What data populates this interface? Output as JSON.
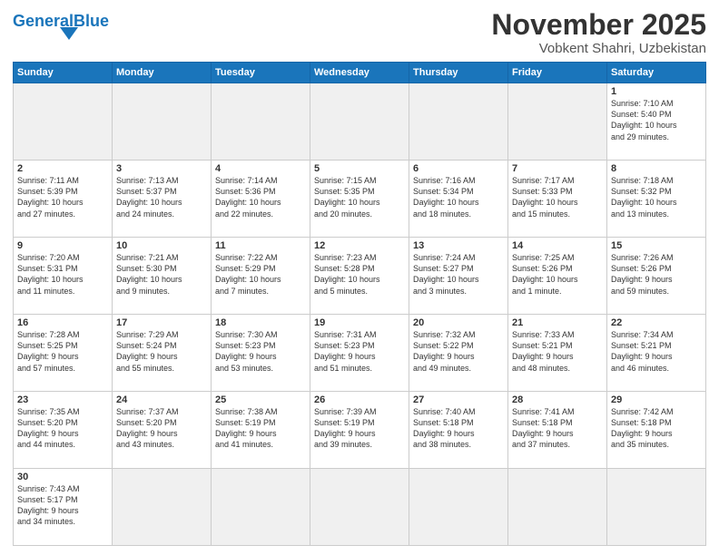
{
  "header": {
    "logo_general": "General",
    "logo_blue": "Blue",
    "month": "November 2025",
    "location": "Vobkent Shahri, Uzbekistan"
  },
  "weekdays": [
    "Sunday",
    "Monday",
    "Tuesday",
    "Wednesday",
    "Thursday",
    "Friday",
    "Saturday"
  ],
  "rows": [
    [
      {
        "day": "",
        "info": "",
        "empty": true
      },
      {
        "day": "",
        "info": "",
        "empty": true
      },
      {
        "day": "",
        "info": "",
        "empty": true
      },
      {
        "day": "",
        "info": "",
        "empty": true
      },
      {
        "day": "",
        "info": "",
        "empty": true
      },
      {
        "day": "",
        "info": "",
        "empty": true
      },
      {
        "day": "1",
        "info": "Sunrise: 7:10 AM\nSunset: 5:40 PM\nDaylight: 10 hours\nand 29 minutes."
      }
    ],
    [
      {
        "day": "2",
        "info": "Sunrise: 7:11 AM\nSunset: 5:39 PM\nDaylight: 10 hours\nand 27 minutes."
      },
      {
        "day": "3",
        "info": "Sunrise: 7:13 AM\nSunset: 5:37 PM\nDaylight: 10 hours\nand 24 minutes."
      },
      {
        "day": "4",
        "info": "Sunrise: 7:14 AM\nSunset: 5:36 PM\nDaylight: 10 hours\nand 22 minutes."
      },
      {
        "day": "5",
        "info": "Sunrise: 7:15 AM\nSunset: 5:35 PM\nDaylight: 10 hours\nand 20 minutes."
      },
      {
        "day": "6",
        "info": "Sunrise: 7:16 AM\nSunset: 5:34 PM\nDaylight: 10 hours\nand 18 minutes."
      },
      {
        "day": "7",
        "info": "Sunrise: 7:17 AM\nSunset: 5:33 PM\nDaylight: 10 hours\nand 15 minutes."
      },
      {
        "day": "8",
        "info": "Sunrise: 7:18 AM\nSunset: 5:32 PM\nDaylight: 10 hours\nand 13 minutes."
      }
    ],
    [
      {
        "day": "9",
        "info": "Sunrise: 7:20 AM\nSunset: 5:31 PM\nDaylight: 10 hours\nand 11 minutes."
      },
      {
        "day": "10",
        "info": "Sunrise: 7:21 AM\nSunset: 5:30 PM\nDaylight: 10 hours\nand 9 minutes."
      },
      {
        "day": "11",
        "info": "Sunrise: 7:22 AM\nSunset: 5:29 PM\nDaylight: 10 hours\nand 7 minutes."
      },
      {
        "day": "12",
        "info": "Sunrise: 7:23 AM\nSunset: 5:28 PM\nDaylight: 10 hours\nand 5 minutes."
      },
      {
        "day": "13",
        "info": "Sunrise: 7:24 AM\nSunset: 5:27 PM\nDaylight: 10 hours\nand 3 minutes."
      },
      {
        "day": "14",
        "info": "Sunrise: 7:25 AM\nSunset: 5:26 PM\nDaylight: 10 hours\nand 1 minute."
      },
      {
        "day": "15",
        "info": "Sunrise: 7:26 AM\nSunset: 5:26 PM\nDaylight: 9 hours\nand 59 minutes."
      }
    ],
    [
      {
        "day": "16",
        "info": "Sunrise: 7:28 AM\nSunset: 5:25 PM\nDaylight: 9 hours\nand 57 minutes."
      },
      {
        "day": "17",
        "info": "Sunrise: 7:29 AM\nSunset: 5:24 PM\nDaylight: 9 hours\nand 55 minutes."
      },
      {
        "day": "18",
        "info": "Sunrise: 7:30 AM\nSunset: 5:23 PM\nDaylight: 9 hours\nand 53 minutes."
      },
      {
        "day": "19",
        "info": "Sunrise: 7:31 AM\nSunset: 5:23 PM\nDaylight: 9 hours\nand 51 minutes."
      },
      {
        "day": "20",
        "info": "Sunrise: 7:32 AM\nSunset: 5:22 PM\nDaylight: 9 hours\nand 49 minutes."
      },
      {
        "day": "21",
        "info": "Sunrise: 7:33 AM\nSunset: 5:21 PM\nDaylight: 9 hours\nand 48 minutes."
      },
      {
        "day": "22",
        "info": "Sunrise: 7:34 AM\nSunset: 5:21 PM\nDaylight: 9 hours\nand 46 minutes."
      }
    ],
    [
      {
        "day": "23",
        "info": "Sunrise: 7:35 AM\nSunset: 5:20 PM\nDaylight: 9 hours\nand 44 minutes."
      },
      {
        "day": "24",
        "info": "Sunrise: 7:37 AM\nSunset: 5:20 PM\nDaylight: 9 hours\nand 43 minutes."
      },
      {
        "day": "25",
        "info": "Sunrise: 7:38 AM\nSunset: 5:19 PM\nDaylight: 9 hours\nand 41 minutes."
      },
      {
        "day": "26",
        "info": "Sunrise: 7:39 AM\nSunset: 5:19 PM\nDaylight: 9 hours\nand 39 minutes."
      },
      {
        "day": "27",
        "info": "Sunrise: 7:40 AM\nSunset: 5:18 PM\nDaylight: 9 hours\nand 38 minutes."
      },
      {
        "day": "28",
        "info": "Sunrise: 7:41 AM\nSunset: 5:18 PM\nDaylight: 9 hours\nand 37 minutes."
      },
      {
        "day": "29",
        "info": "Sunrise: 7:42 AM\nSunset: 5:18 PM\nDaylight: 9 hours\nand 35 minutes."
      }
    ],
    [
      {
        "day": "30",
        "info": "Sunrise: 7:43 AM\nSunset: 5:17 PM\nDaylight: 9 hours\nand 34 minutes."
      },
      {
        "day": "",
        "info": "",
        "empty": true
      },
      {
        "day": "",
        "info": "",
        "empty": true
      },
      {
        "day": "",
        "info": "",
        "empty": true
      },
      {
        "day": "",
        "info": "",
        "empty": true
      },
      {
        "day": "",
        "info": "",
        "empty": true
      },
      {
        "day": "",
        "info": "",
        "empty": true
      }
    ]
  ]
}
